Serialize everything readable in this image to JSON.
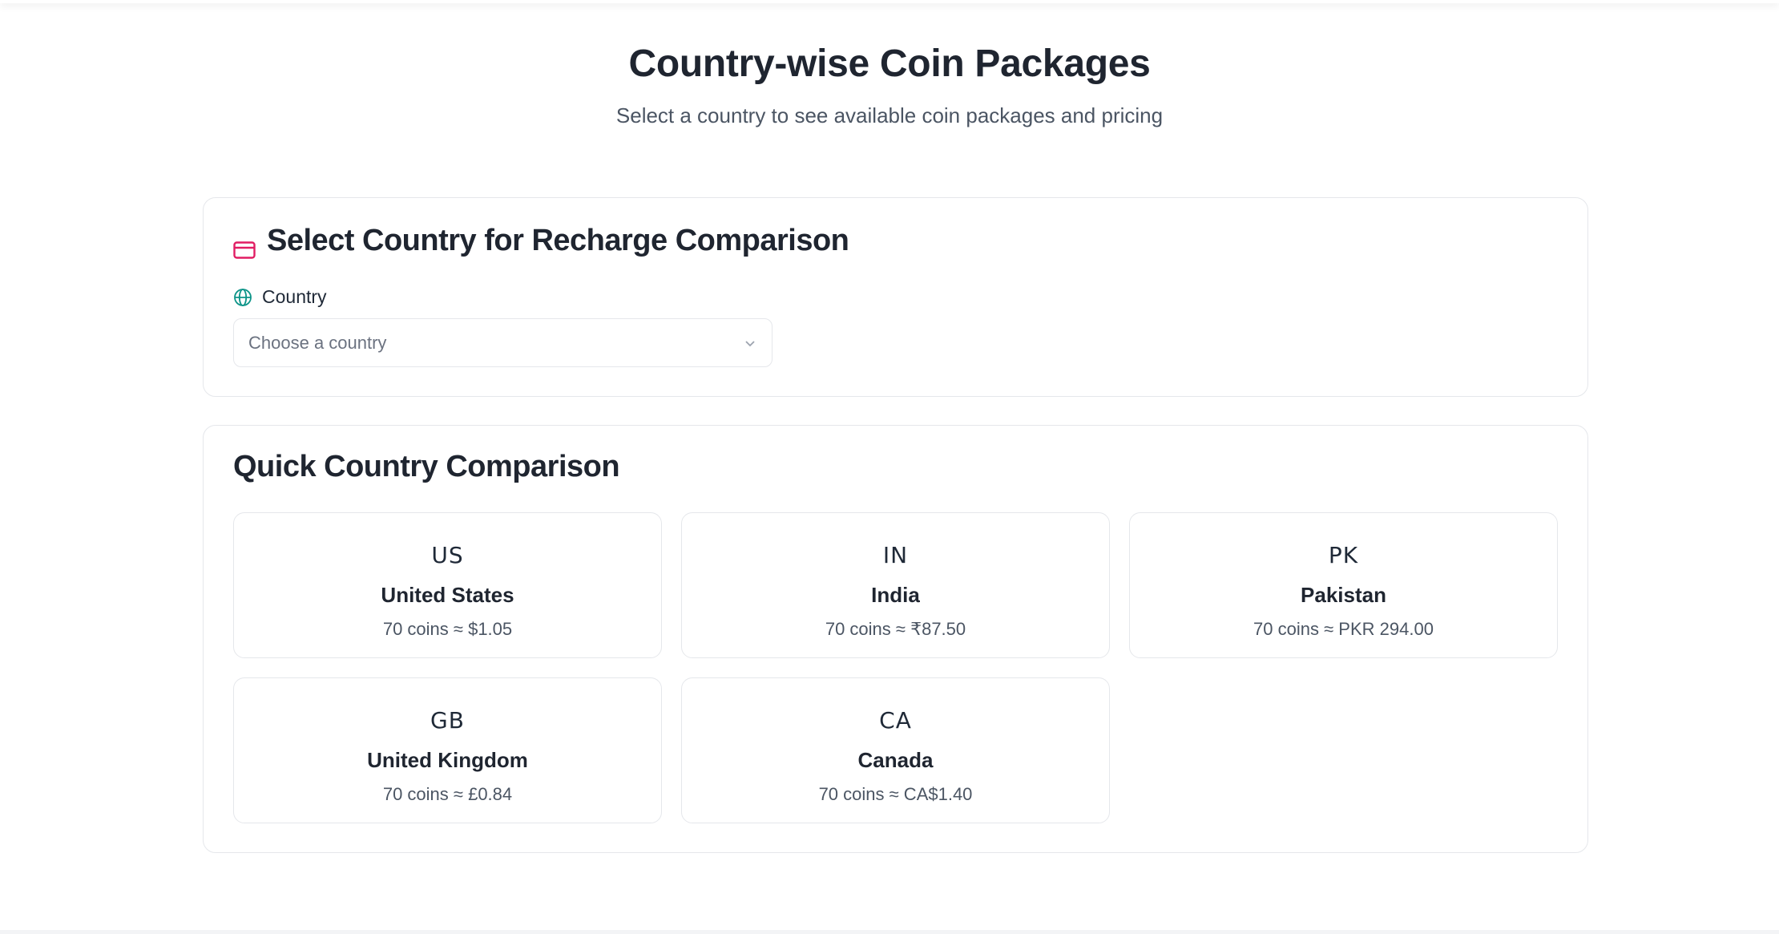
{
  "header": {
    "title": "Country-wise Coin Packages",
    "subtitle": "Select a country to see available coin packages and pricing"
  },
  "select_section": {
    "heading": "Select Country for Recharge Comparison",
    "heading_icon": "credit-card-icon",
    "field_label": "Country",
    "field_icon": "globe-icon",
    "placeholder": "Choose a country"
  },
  "comparison": {
    "heading": "Quick Country Comparison",
    "countries": [
      {
        "code": "US",
        "name": "United States",
        "price": "70 coins ≈ $1.05"
      },
      {
        "code": "IN",
        "name": "India",
        "price": "70 coins ≈ ₹87.50"
      },
      {
        "code": "PK",
        "name": "Pakistan",
        "price": "70 coins ≈ PKR 294.00"
      },
      {
        "code": "GB",
        "name": "United Kingdom",
        "price": "70 coins ≈ £0.84"
      },
      {
        "code": "CA",
        "name": "Canada",
        "price": "70 coins ≈ CA$1.40"
      }
    ]
  },
  "colors": {
    "accent_pink": "#e11d63",
    "accent_teal": "#0d9488",
    "border": "#e5e7eb"
  }
}
